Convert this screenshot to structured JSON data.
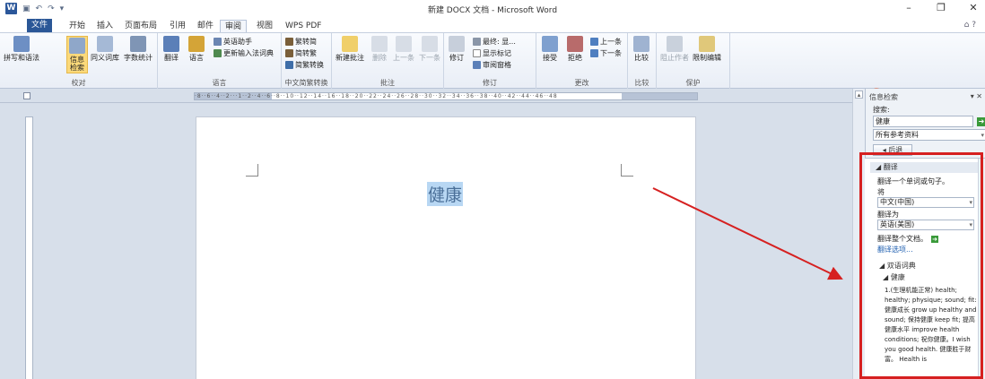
{
  "window": {
    "title": "新建 DOCX 文档 - Microsoft Word",
    "app_icon": "word-icon",
    "controls": [
      "minimize-icon",
      "restore-icon",
      "close-icon"
    ]
  },
  "tabs": [
    {
      "label": "文件"
    },
    {
      "label": "开始"
    },
    {
      "label": "插入"
    },
    {
      "label": "页面布局"
    },
    {
      "label": "引用"
    },
    {
      "label": "邮件"
    },
    {
      "label": "审阅"
    },
    {
      "label": "视图"
    },
    {
      "label": "WPS PDF"
    }
  ],
  "ribbon": {
    "proofing": {
      "label": "校对",
      "spell": "拼写和语法",
      "research": "信息检索",
      "thesaurus": "同义词库",
      "wordcount": "字数统计"
    },
    "language": {
      "label": "语言",
      "translate": "翻译",
      "language": "语言",
      "english_assist": "英语助手",
      "update_ime": "更新输入法词典"
    },
    "chinese_conv": {
      "label": "中文简繁转换",
      "to_simplified": "繁转简",
      "to_traditional": "简转繁",
      "convert": "简繁转换"
    },
    "comments": {
      "label": "批注",
      "new": "新建批注",
      "delete": "删除",
      "prev": "上一条",
      "next": "下一条"
    },
    "tracking": {
      "label": "修订",
      "track": "修订",
      "final_show": "最终: 显...",
      "show_markup": "显示标记",
      "review_pane": "审阅窗格"
    },
    "changes": {
      "label": "更改",
      "accept": "接受",
      "reject": "拒绝",
      "prev": "上一条",
      "next": "下一条"
    },
    "compare": {
      "label": "比较",
      "compare": "比较"
    },
    "protect": {
      "label": "保护",
      "block_authors": "阻止作者",
      "restrict": "限制编辑"
    }
  },
  "ruler_ticks": "·8··6··4··2···1··2··4··6··8··10··12··14··16··18··20··22··24··26··28··30··32··34··36··38··40··42··44··46··48",
  "document": {
    "selected_text": "健康"
  },
  "research_pane": {
    "title": "信息检索",
    "search_label": "搜索:",
    "search_value": "健康",
    "source": "所有参考资料",
    "back_button": "◂ 后退",
    "translate_section": "翻译",
    "translate_hint": "翻译一个单词或句子。",
    "from_label": "将",
    "from_lang": "中文(中国)",
    "to_label": "翻译为",
    "to_lang": "英语(美国)",
    "translate_doc": "翻译整个文档。",
    "options_link": "翻译选项...",
    "dict_section": "双语词典",
    "term": "健康",
    "entry": "1.(生理机能正常) health; healthy; physique; sound; fit: 健康成长 grow up healthy and sound; 保持健康 keep fit; 提高健康水平 improve health conditions; 祝你健康。I wish you good health. 健康胜于财富。 Health is"
  },
  "annotation": {
    "box_color": "#d62020",
    "arrow_color": "#d62020"
  }
}
